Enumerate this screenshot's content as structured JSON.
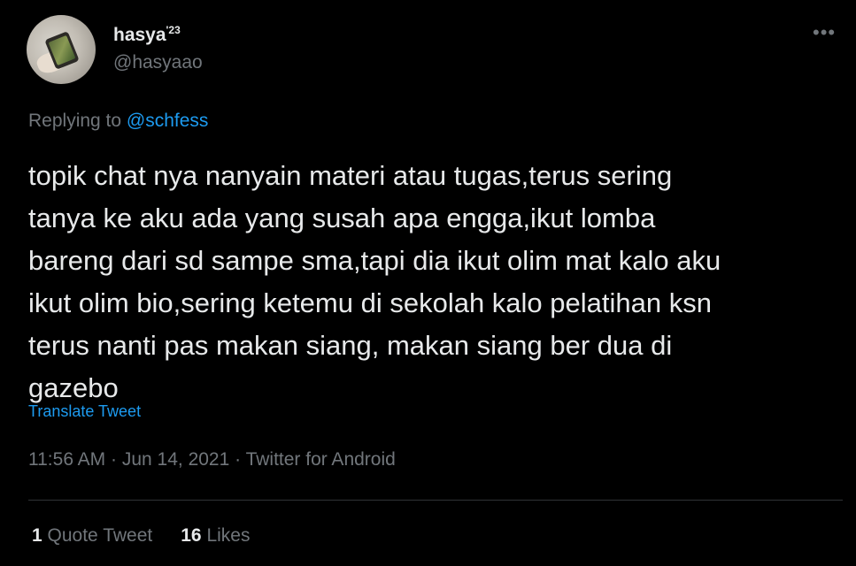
{
  "author": {
    "name": "hasya",
    "name_suffix": "'23",
    "handle": "@hasyaao"
  },
  "more_icon": "more-horizontal-icon",
  "reply": {
    "prefix": "Replying to",
    "to_handle": "@schfess"
  },
  "tweet": {
    "text": "topik chat nya nanyain materi atau tugas,terus sering\ntanya ke aku ada yang susah apa engga,ikut lomba\nbareng dari sd sampe sma,tapi dia ikut olim mat kalo aku\nikut olim bio,sering ketemu di sekolah kalo pelatihan ksn\nterus nanti pas makan siang, makan siang ber dua di\ngazebo",
    "translate_label": "Translate Tweet"
  },
  "meta": {
    "time": "11:56 AM",
    "date": "Jun 14, 2021",
    "source": "Twitter for Android"
  },
  "stats": {
    "quote_count": "1",
    "quote_label": "Quote Tweet",
    "like_count": "16",
    "like_label": "Likes"
  },
  "colors": {
    "background": "#000000",
    "text": "#e7e9ea",
    "secondary": "#71767b",
    "link": "#1d9bf0",
    "divider": "#2f3336"
  }
}
